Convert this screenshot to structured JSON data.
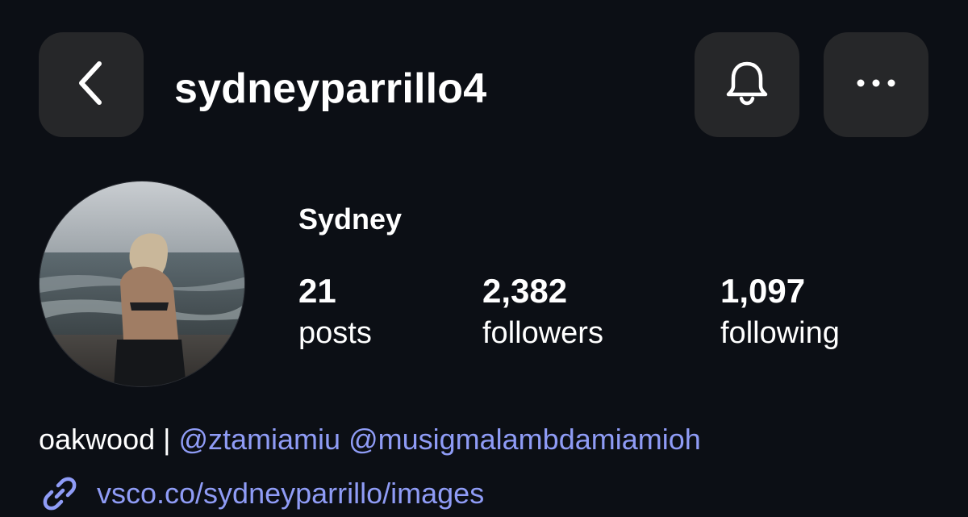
{
  "header": {
    "back_icon": "chevron-left-icon",
    "username": "sydneyparrillo4",
    "notifications_icon": "bell-icon",
    "more_icon": "more-horizontal-icon"
  },
  "profile": {
    "display_name": "Sydney",
    "stats": {
      "posts": {
        "value": "21",
        "label": "posts"
      },
      "followers": {
        "value": "2,382",
        "label": "followers"
      },
      "following": {
        "value": "1,097",
        "label": "following"
      }
    },
    "bio": {
      "text": "oakwood | ",
      "mentions": [
        "@ztamiamiu",
        "@musigmalambdamiamioh"
      ]
    },
    "link": {
      "icon": "link-icon",
      "text": "vsco.co/sydneyparrillo/images"
    }
  },
  "colors": {
    "background": "#0c0f15",
    "button_bg": "#262729",
    "accent_link": "#8f9cf6",
    "text": "#ffffff"
  }
}
